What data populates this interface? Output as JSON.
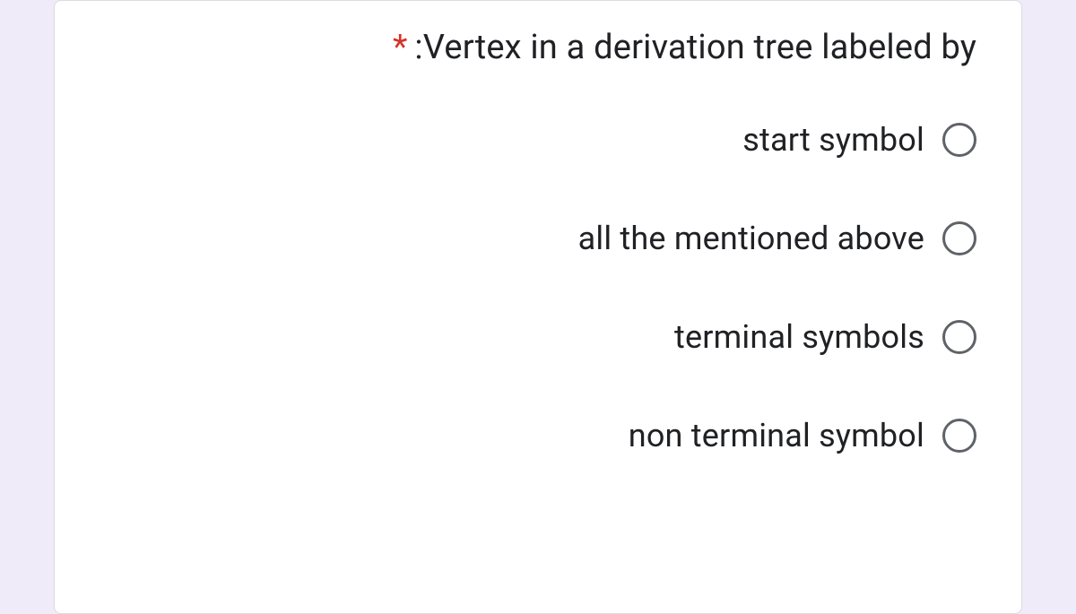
{
  "question": {
    "required_marker": "*",
    "text": ":Vertex in a derivation tree labeled by"
  },
  "options": [
    {
      "label": "start symbol"
    },
    {
      "label": "all the mentioned above"
    },
    {
      "label": "terminal symbols"
    },
    {
      "label": "non terminal symbol"
    }
  ]
}
